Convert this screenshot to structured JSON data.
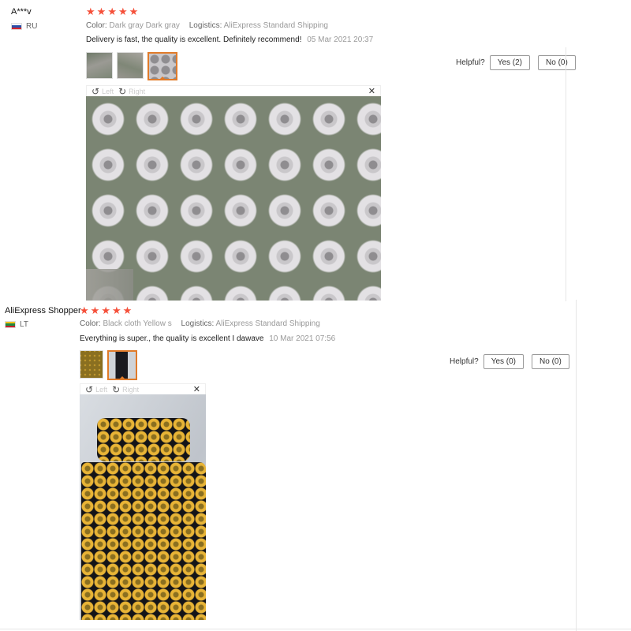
{
  "reviews": [
    {
      "author": "A***v",
      "country": "RU",
      "rating": 5,
      "color_label": "Color:",
      "color_value": "Dark gray Dark gray",
      "logistics_label": "Logistics:",
      "logistics_value": "AliExpress Standard Shipping",
      "text": "Delivery is fast, the quality is excellent. Definitely recommend!",
      "date": "05 Mar 2021 20:37",
      "helpful_label": "Helpful?",
      "yes_label": "Yes (2)",
      "no_label": "No (0)",
      "viewer": {
        "left_label": "Left",
        "right_label": "Right",
        "close_label": "✕"
      }
    },
    {
      "author": "AliExpress Shopper",
      "country": "LT",
      "rating": 5,
      "color_label": "Color:",
      "color_value": "Black cloth Yellow s",
      "logistics_label": "Logistics:",
      "logistics_value": "AliExpress Standard Shipping",
      "text": "Everything is super., the quality is excellent I dawave",
      "date": "10 Mar 2021 07:56",
      "helpful_label": "Helpful?",
      "yes_label": "Yes (0)",
      "no_label": "No (0)",
      "viewer": {
        "left_label": "Left",
        "right_label": "Right",
        "close_label": "✕"
      }
    }
  ],
  "colors": {
    "star": "#f5503a",
    "selected_thumb": "#e07b2a"
  },
  "icons": {
    "star": "star-icon",
    "rotate_left": "rotate-left-icon",
    "rotate_right": "rotate-right-icon",
    "close": "close-icon"
  }
}
